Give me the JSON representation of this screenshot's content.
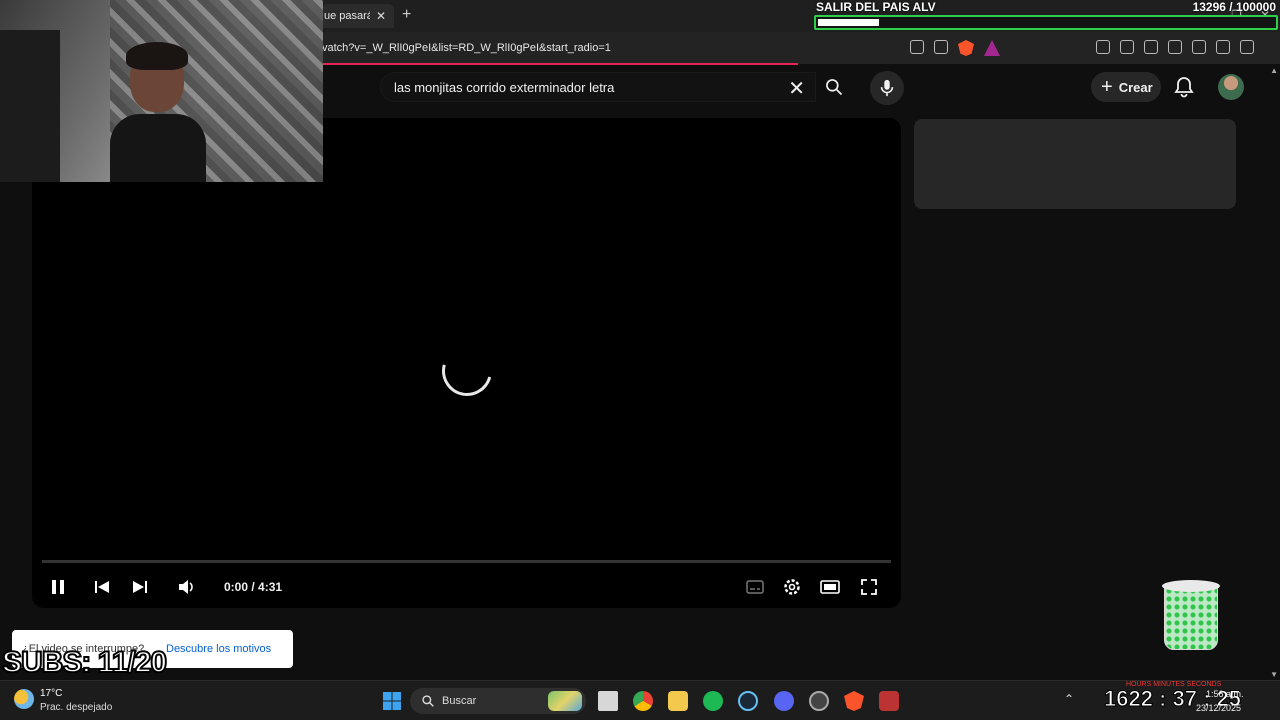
{
  "browser": {
    "tab_title": "ue pasará",
    "tab_close": "✕",
    "new_tab": "+",
    "url": "vatch?v=_W_RlI0gPeI&list=RD_W_RlI0gPeI&start_radio=1"
  },
  "youtube": {
    "search_query": "las monjitas corrido exterminador letra",
    "search_clear": "✕",
    "create_label": "Crear",
    "create_plus": "+"
  },
  "player": {
    "time": "0:00 / 4:31",
    "progress": 0
  },
  "overlay": {
    "goal_title": "SALIR DEL PAIS ALV",
    "goal_count": "13296  / 100000",
    "goal_progress": 0.133,
    "subs": "SUBS: 11/20",
    "toast_question": "¿El video se interrumpe?",
    "toast_link": "Descubre los motivos"
  },
  "taskbar": {
    "temperature": "17°C",
    "weather": "Prac. despejado",
    "search_label": "Buscar",
    "time": "1:56 a.m.",
    "date": "23/12/2025",
    "timer": "1622 : 37 : 25",
    "timer_labels": "HOURS     MINUTES     SECONDS"
  },
  "colors": {
    "accent_red": "#e3245d",
    "goal_green": "#2ed04a",
    "link_blue": "#065fd4"
  },
  "icons": [
    "search-icon",
    "mic-icon",
    "bell-icon",
    "pause-icon",
    "prev-icon",
    "next-icon",
    "volume-icon",
    "captions-icon",
    "settings-icon",
    "theater-icon",
    "fullscreen-icon",
    "windows-start-icon",
    "chrome-icon",
    "spotify-icon",
    "steam-icon",
    "discord-icon",
    "brave-icon"
  ]
}
